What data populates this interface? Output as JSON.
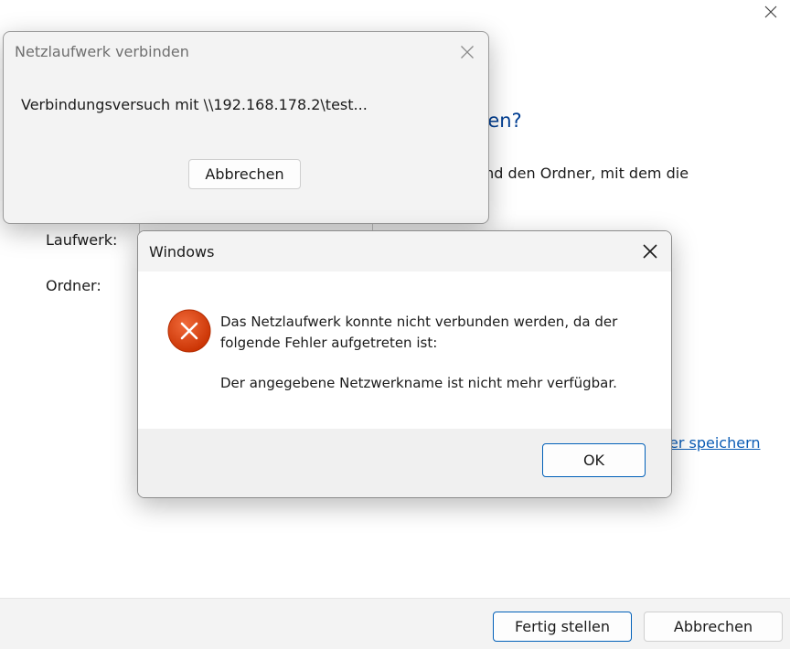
{
  "wizard": {
    "heading_fragment": "den?",
    "description_fragment": "und den Ordner, mit dem die",
    "drive_label": "Laufwerk:",
    "folder_label": "Ordner:",
    "link_fragment": "er speichern",
    "finish_button": "Fertig stellen",
    "cancel_button": "Abbrechen"
  },
  "progress_dialog": {
    "title": "Netzlaufwerk verbinden",
    "message": "Verbindungsversuch mit \\\\192.168.178.2\\test...",
    "cancel_button": "Abbrechen"
  },
  "error_dialog": {
    "title": "Windows",
    "message_line": "Das Netzlaufwerk konnte nicht verbunden werden, da der folgende Fehler aufgetreten ist:",
    "detail": "Der angegebene Netzwerkname ist nicht mehr verfügbar.",
    "ok_button": "OK",
    "icon": "error-icon",
    "icon_color": "#d83b01"
  },
  "colors": {
    "accent": "#005fb8",
    "heading": "#003e92",
    "link": "#0b5cb5"
  }
}
